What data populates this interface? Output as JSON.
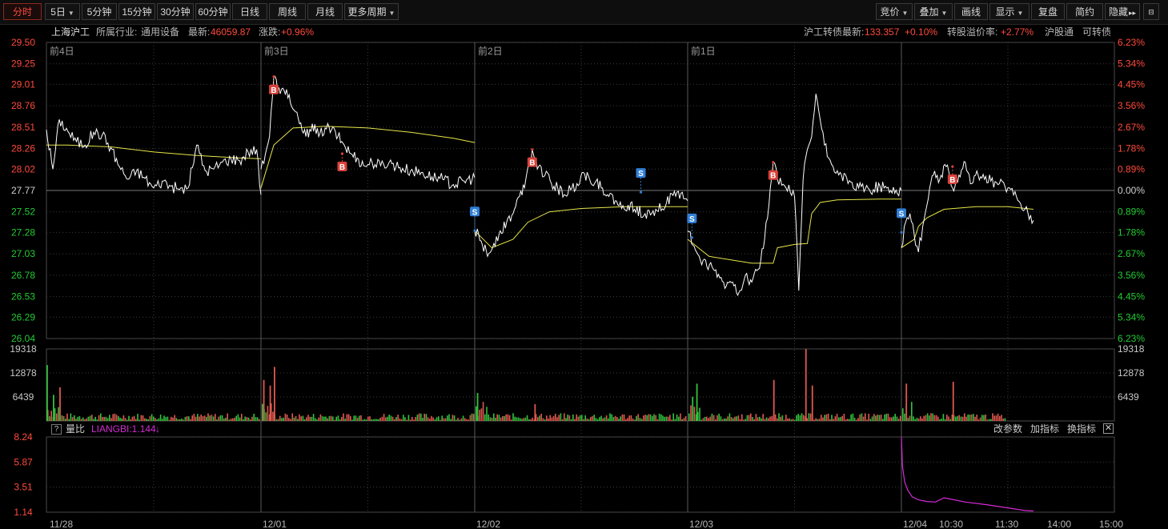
{
  "toolbar": {
    "left": [
      {
        "label": "分时",
        "active": true,
        "dropdown": false
      },
      {
        "label": "5日",
        "active": false,
        "dropdown": true
      },
      {
        "label": "5分钟",
        "active": false,
        "dropdown": false
      },
      {
        "label": "15分钟",
        "active": false,
        "dropdown": false
      },
      {
        "label": "30分钟",
        "active": false,
        "dropdown": false
      },
      {
        "label": "60分钟",
        "active": false,
        "dropdown": false
      },
      {
        "label": "日线",
        "active": false,
        "dropdown": false
      },
      {
        "label": "周线",
        "active": false,
        "dropdown": false
      },
      {
        "label": "月线",
        "active": false,
        "dropdown": false
      },
      {
        "label": "更多周期",
        "active": false,
        "dropdown": true
      }
    ],
    "right": [
      {
        "label": "竞价",
        "dropdown": true
      },
      {
        "label": "叠加",
        "dropdown": true
      },
      {
        "label": "画线",
        "dropdown": false
      },
      {
        "label": "显示",
        "dropdown": true
      },
      {
        "label": "复盘",
        "dropdown": false
      },
      {
        "label": "简约",
        "dropdown": false
      },
      {
        "label": "隐藏",
        "dropdown": false,
        "suffix": "▸▸"
      }
    ],
    "panel_toggle_icon": "collapse-panel-icon"
  },
  "info": {
    "stock_name": "上海沪工",
    "industry_label": "所属行业:",
    "industry": "通用设备",
    "latest_label": "最新:",
    "latest": "46059.87",
    "change_label": "涨跌:",
    "change": "+0.96%",
    "bond_label": "沪工转债最新:",
    "bond_price": "133.357",
    "bond_change": "+0.10%",
    "premium_label": "转股溢价率:",
    "premium": "+2.77%",
    "link1": "沪股通",
    "link2": "可转债"
  },
  "colors": {
    "up": "#ff4a3c",
    "down": "#22cc33",
    "price_line": "#ffffff",
    "avg_line": "#e6e64a",
    "liangbi_line": "#d62bd6",
    "grid": "#3c3c3c",
    "day_divider": "#5a5a5a"
  },
  "chart_data": {
    "type": "line",
    "title": "上海沪工 5日分时",
    "price_axis": {
      "ticks": [
        "29.50",
        "29.25",
        "29.01",
        "28.76",
        "28.51",
        "28.26",
        "28.02",
        "27.77",
        "27.52",
        "27.28",
        "27.03",
        "26.78",
        "26.53",
        "26.29",
        "26.04"
      ],
      "ylim": [
        26.04,
        29.5
      ],
      "prev_close": 27.77
    },
    "pct_axis": {
      "ticks": [
        "6.23%",
        "5.34%",
        "4.45%",
        "3.56%",
        "2.67%",
        "1.78%",
        "0.89%",
        "0.00%",
        "0.89%",
        "1.78%",
        "2.67%",
        "3.56%",
        "4.45%",
        "5.34%",
        "6.23%"
      ]
    },
    "day_labels": [
      "前4日",
      "前3日",
      "前2日",
      "前1日"
    ],
    "x_labels": [
      "11/28",
      "12/01",
      "12/02",
      "12/03",
      "12/04",
      "10:30",
      "11:30",
      "14:00",
      "15:00"
    ],
    "series": [
      {
        "name": "价格",
        "days": [
          [
            [
              0,
              28.48
            ],
            [
              3,
              28.02
            ],
            [
              6,
              28.6
            ],
            [
              10,
              28.46
            ],
            [
              14,
              28.34
            ],
            [
              18,
              28.3
            ],
            [
              22,
              28.45
            ],
            [
              26,
              28.42
            ],
            [
              30,
              28.27
            ],
            [
              34,
              28.05
            ],
            [
              38,
              27.9
            ],
            [
              42,
              28.0
            ],
            [
              46,
              27.91
            ],
            [
              50,
              27.8
            ],
            [
              54,
              27.88
            ],
            [
              58,
              27.82
            ],
            [
              62,
              27.78
            ],
            [
              66,
              27.8
            ],
            [
              70,
              28.3
            ],
            [
              74,
              28.0
            ],
            [
              78,
              28.02
            ],
            [
              82,
              28.1
            ],
            [
              86,
              28.14
            ],
            [
              90,
              28.12
            ],
            [
              94,
              28.22
            ],
            [
              98,
              28.25
            ],
            [
              100,
              27.72
            ]
          ],
          [
            [
              0,
              28.02
            ],
            [
              4,
              28.4
            ],
            [
              6,
              29.1
            ],
            [
              9,
              28.9
            ],
            [
              12,
              28.95
            ],
            [
              15,
              28.72
            ],
            [
              18,
              28.55
            ],
            [
              21,
              28.4
            ],
            [
              24,
              28.55
            ],
            [
              27,
              28.4
            ],
            [
              30,
              28.5
            ],
            [
              33,
              28.48
            ],
            [
              36,
              28.4
            ],
            [
              39,
              28.3
            ],
            [
              42,
              28.2
            ],
            [
              45,
              28.15
            ],
            [
              48,
              28.06
            ],
            [
              52,
              28.1
            ],
            [
              56,
              28.06
            ],
            [
              60,
              28.1
            ],
            [
              65,
              28.04
            ],
            [
              70,
              28.0
            ],
            [
              75,
              27.98
            ],
            [
              80,
              27.93
            ],
            [
              85,
              27.9
            ],
            [
              90,
              27.84
            ],
            [
              95,
              27.88
            ],
            [
              100,
              27.92
            ]
          ],
          [
            [
              0,
              27.3
            ],
            [
              3,
              27.18
            ],
            [
              6,
              27.0
            ],
            [
              9,
              27.15
            ],
            [
              12,
              27.3
            ],
            [
              15,
              27.4
            ],
            [
              18,
              27.5
            ],
            [
              21,
              27.7
            ],
            [
              24,
              27.9
            ],
            [
              27,
              28.25
            ],
            [
              30,
              28.05
            ],
            [
              33,
              27.95
            ],
            [
              36,
              27.85
            ],
            [
              39,
              27.8
            ],
            [
              42,
              27.72
            ],
            [
              45,
              27.78
            ],
            [
              48,
              27.85
            ],
            [
              51,
              27.98
            ],
            [
              54,
              27.9
            ],
            [
              57,
              27.88
            ],
            [
              60,
              27.8
            ],
            [
              63,
              27.7
            ],
            [
              66,
              27.65
            ],
            [
              69,
              27.56
            ],
            [
              72,
              27.6
            ],
            [
              75,
              27.55
            ],
            [
              80,
              27.5
            ],
            [
              85,
              27.55
            ],
            [
              90,
              27.62
            ],
            [
              95,
              27.75
            ],
            [
              100,
              27.65
            ]
          ],
          [
            [
              0,
              27.3
            ],
            [
              3,
              27.12
            ],
            [
              6,
              26.95
            ],
            [
              9,
              26.88
            ],
            [
              12,
              26.85
            ],
            [
              15,
              26.75
            ],
            [
              18,
              26.65
            ],
            [
              21,
              26.7
            ],
            [
              24,
              26.58
            ],
            [
              27,
              26.78
            ],
            [
              30,
              26.7
            ],
            [
              33,
              26.85
            ],
            [
              36,
              27.2
            ],
            [
              38,
              27.6
            ],
            [
              40,
              28.1
            ],
            [
              42,
              27.9
            ],
            [
              46,
              27.8
            ],
            [
              50,
              27.7
            ],
            [
              52,
              26.6
            ],
            [
              54,
              27.9
            ],
            [
              56,
              28.25
            ],
            [
              58,
              28.4
            ],
            [
              60,
              28.9
            ],
            [
              62,
              28.6
            ],
            [
              64,
              28.3
            ],
            [
              66,
              28.15
            ],
            [
              68,
              28.05
            ],
            [
              70,
              28.0
            ],
            [
              72,
              27.95
            ],
            [
              75,
              27.85
            ],
            [
              80,
              27.8
            ],
            [
              85,
              27.78
            ],
            [
              90,
              27.82
            ],
            [
              95,
              27.77
            ],
            [
              100,
              27.77
            ]
          ],
          [
            [
              0,
              27.1
            ],
            [
              2,
              27.4
            ],
            [
              4,
              27.5
            ],
            [
              6,
              27.25
            ],
            [
              8,
              27.05
            ],
            [
              10,
              27.35
            ],
            [
              12,
              27.6
            ],
            [
              15,
              27.95
            ],
            [
              18,
              27.9
            ],
            [
              21,
              28.05
            ],
            [
              24,
              27.8
            ],
            [
              27,
              27.95
            ],
            [
              30,
              28.1
            ],
            [
              33,
              27.85
            ],
            [
              36,
              27.95
            ],
            [
              39,
              27.9
            ],
            [
              42,
              27.88
            ],
            [
              46,
              27.85
            ],
            [
              50,
              27.8
            ],
            [
              54,
              27.7
            ],
            [
              58,
              27.55
            ],
            [
              62,
              27.42
            ]
          ]
        ]
      },
      {
        "name": "均价",
        "days": [
          [
            [
              0,
              28.3
            ],
            [
              10,
              28.3
            ],
            [
              30,
              28.28
            ],
            [
              50,
              28.22
            ],
            [
              70,
              28.18
            ],
            [
              90,
              28.15
            ],
            [
              100,
              28.14
            ]
          ],
          [
            [
              0,
              27.8
            ],
            [
              6,
              28.3
            ],
            [
              15,
              28.5
            ],
            [
              30,
              28.52
            ],
            [
              50,
              28.5
            ],
            [
              70,
              28.45
            ],
            [
              90,
              28.38
            ],
            [
              100,
              28.33
            ]
          ],
          [
            [
              0,
              27.3
            ],
            [
              8,
              27.1
            ],
            [
              18,
              27.2
            ],
            [
              25,
              27.4
            ],
            [
              35,
              27.52
            ],
            [
              50,
              27.56
            ],
            [
              70,
              27.58
            ],
            [
              90,
              27.58
            ],
            [
              100,
              27.58
            ]
          ],
          [
            [
              0,
              27.2
            ],
            [
              10,
              27.0
            ],
            [
              30,
              26.92
            ],
            [
              40,
              26.92
            ],
            [
              42,
              27.1
            ],
            [
              50,
              27.14
            ],
            [
              56,
              27.15
            ],
            [
              58,
              27.5
            ],
            [
              62,
              27.63
            ],
            [
              70,
              27.66
            ],
            [
              90,
              27.67
            ],
            [
              100,
              27.67
            ]
          ],
          [
            [
              0,
              27.1
            ],
            [
              6,
              27.2
            ],
            [
              8,
              27.35
            ],
            [
              12,
              27.45
            ],
            [
              20,
              27.55
            ],
            [
              35,
              27.58
            ],
            [
              50,
              27.58
            ],
            [
              62,
              27.55
            ]
          ]
        ]
      }
    ],
    "trade_markers": [
      {
        "day": 1,
        "t": 6,
        "type": "B",
        "price": 29.1
      },
      {
        "day": 1,
        "t": 38,
        "type": "B",
        "price": 28.2
      },
      {
        "day": 2,
        "t": 0,
        "type": "S",
        "price": 27.3
      },
      {
        "day": 2,
        "t": 27,
        "type": "B",
        "price": 28.25
      },
      {
        "day": 2,
        "t": 78,
        "type": "S",
        "price": 27.75
      },
      {
        "day": 3,
        "t": 2,
        "type": "S",
        "price": 27.22
      },
      {
        "day": 3,
        "t": 40,
        "type": "B",
        "price": 28.1
      },
      {
        "day": 4,
        "t": 0,
        "type": "S",
        "price": 27.28
      },
      {
        "day": 4,
        "t": 24,
        "type": "B",
        "price": 28.05
      }
    ],
    "volume": {
      "ticks": [
        "19318",
        "12878",
        "6439"
      ],
      "max": 19318,
      "spikes": [
        {
          "day": 0,
          "t": 0,
          "value": 15000,
          "up": false
        },
        {
          "day": 0,
          "t": 6,
          "value": 9000,
          "up": true
        },
        {
          "day": 0,
          "t": 3,
          "value": 7000,
          "up": false
        },
        {
          "day": 1,
          "t": 1,
          "value": 11000,
          "up": true
        },
        {
          "day": 1,
          "t": 6,
          "value": 14500,
          "up": true
        },
        {
          "day": 1,
          "t": 4,
          "value": 9500,
          "up": true
        },
        {
          "day": 2,
          "t": 1,
          "value": 7500,
          "up": false
        },
        {
          "day": 2,
          "t": 28,
          "value": 4500,
          "up": true
        },
        {
          "day": 3,
          "t": 2,
          "value": 6500,
          "up": false
        },
        {
          "day": 3,
          "t": 4,
          "value": 10000,
          "up": false
        },
        {
          "day": 3,
          "t": 40,
          "value": 11000,
          "up": true
        },
        {
          "day": 3,
          "t": 55,
          "value": 19300,
          "up": true
        },
        {
          "day": 3,
          "t": 58,
          "value": 9500,
          "up": true
        },
        {
          "day": 4,
          "t": 2,
          "value": 10000,
          "up": true
        },
        {
          "day": 4,
          "t": 24,
          "value": 10500,
          "up": true
        }
      ]
    },
    "liangbi": {
      "ticks": [
        "8.24",
        "5.87",
        "3.51",
        "1.14"
      ],
      "ylim": [
        1.14,
        8.24
      ],
      "points": [
        [
          0,
          8.24
        ],
        [
          0.5,
          5.5
        ],
        [
          1.5,
          4.0
        ],
        [
          3,
          3.2
        ],
        [
          5,
          2.6
        ],
        [
          8,
          2.3
        ],
        [
          12,
          2.15
        ],
        [
          16,
          2.1
        ],
        [
          20,
          2.5
        ],
        [
          25,
          2.3
        ],
        [
          30,
          2.1
        ],
        [
          40,
          1.85
        ],
        [
          50,
          1.55
        ],
        [
          58,
          1.3
        ],
        [
          62,
          1.25
        ]
      ]
    }
  },
  "indicator": {
    "help": "?",
    "name": "量比",
    "value_label": "LIANGBI:1.144",
    "arrow": "↓",
    "actions": [
      "改参数",
      "加指标",
      "换指标"
    ],
    "close": "✕"
  }
}
